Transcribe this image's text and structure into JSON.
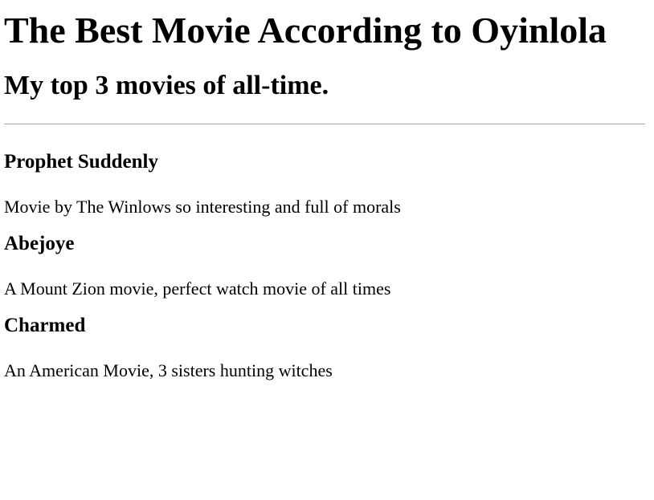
{
  "header": {
    "title": "The Best Movie According to Oyinlola",
    "subtitle": "My top 3 movies of all-time."
  },
  "movies": [
    {
      "title": "Prophet Suddenly",
      "description": "Movie by The Winlows so interesting and full of morals"
    },
    {
      "title": "Abejoye",
      "description": "A Mount Zion movie, perfect watch movie of all times"
    },
    {
      "title": "Charmed",
      "description": "An American Movie, 3 sisters hunting witches"
    }
  ]
}
